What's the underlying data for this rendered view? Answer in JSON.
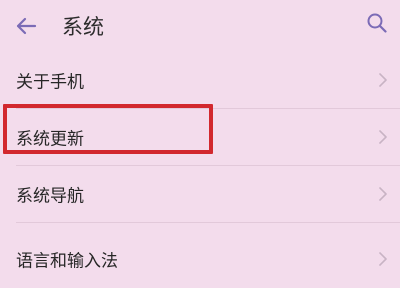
{
  "header": {
    "title": "系统",
    "back_icon": "back-arrow-icon",
    "search_icon": "search-icon"
  },
  "menu": {
    "items": [
      {
        "label": "关于手机"
      },
      {
        "label": "系统更新"
      },
      {
        "label": "系统导航"
      },
      {
        "label": "语言和输入法"
      }
    ]
  },
  "colors": {
    "background": "#f3dcec",
    "accent": "#7b6bb6",
    "highlight": "#d2282e"
  }
}
